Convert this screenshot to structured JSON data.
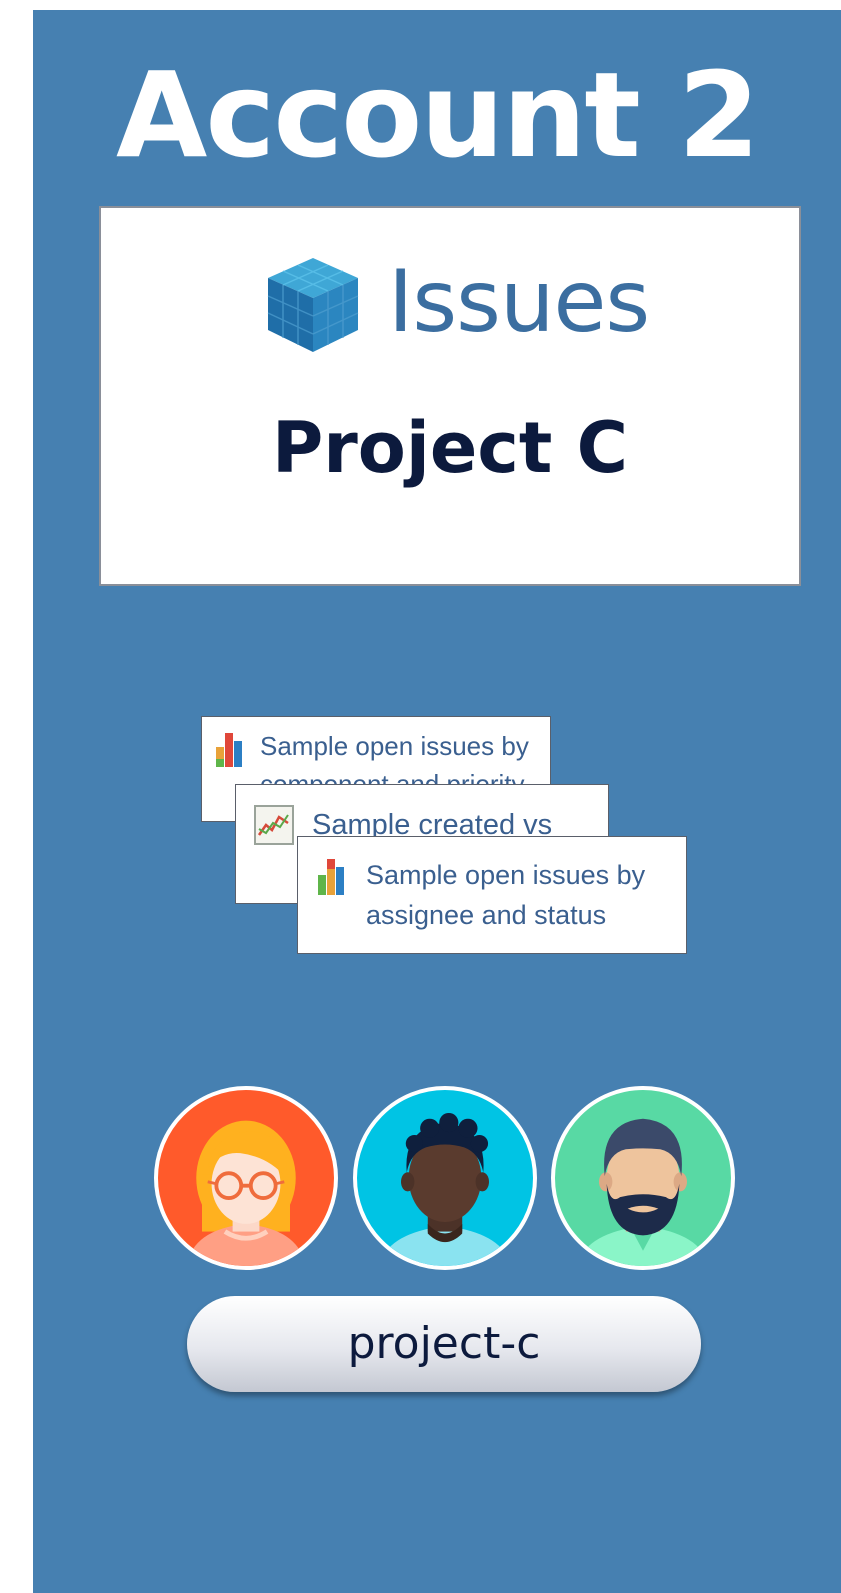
{
  "account": {
    "title": "Account 2"
  },
  "project_card": {
    "logo_text": "Issues",
    "logo_icon": "cube-icon",
    "project_name": "Project C"
  },
  "gadgets": [
    {
      "label": "Sample open issues by\ncomponent and priority",
      "icon": "bar-chart-icon"
    },
    {
      "label": "Sample created vs",
      "icon": "line-chart-icon"
    },
    {
      "label": "Sample open issues by\nassignee and status",
      "icon": "bar-chart-icon"
    }
  ],
  "members": [
    {
      "icon": "avatar-woman-glasses-icon",
      "bg": "#ff5a2b"
    },
    {
      "icon": "avatar-man-icon",
      "bg": "#00c4e4"
    },
    {
      "icon": "avatar-bearded-man-icon",
      "bg": "#58d9a4"
    }
  ],
  "repo": {
    "label": "project-c"
  },
  "colors": {
    "panel": "#4680b1",
    "title_text": "#ffffff",
    "project_text": "#0c1a3d",
    "issues_text": "#3b6ea0"
  }
}
